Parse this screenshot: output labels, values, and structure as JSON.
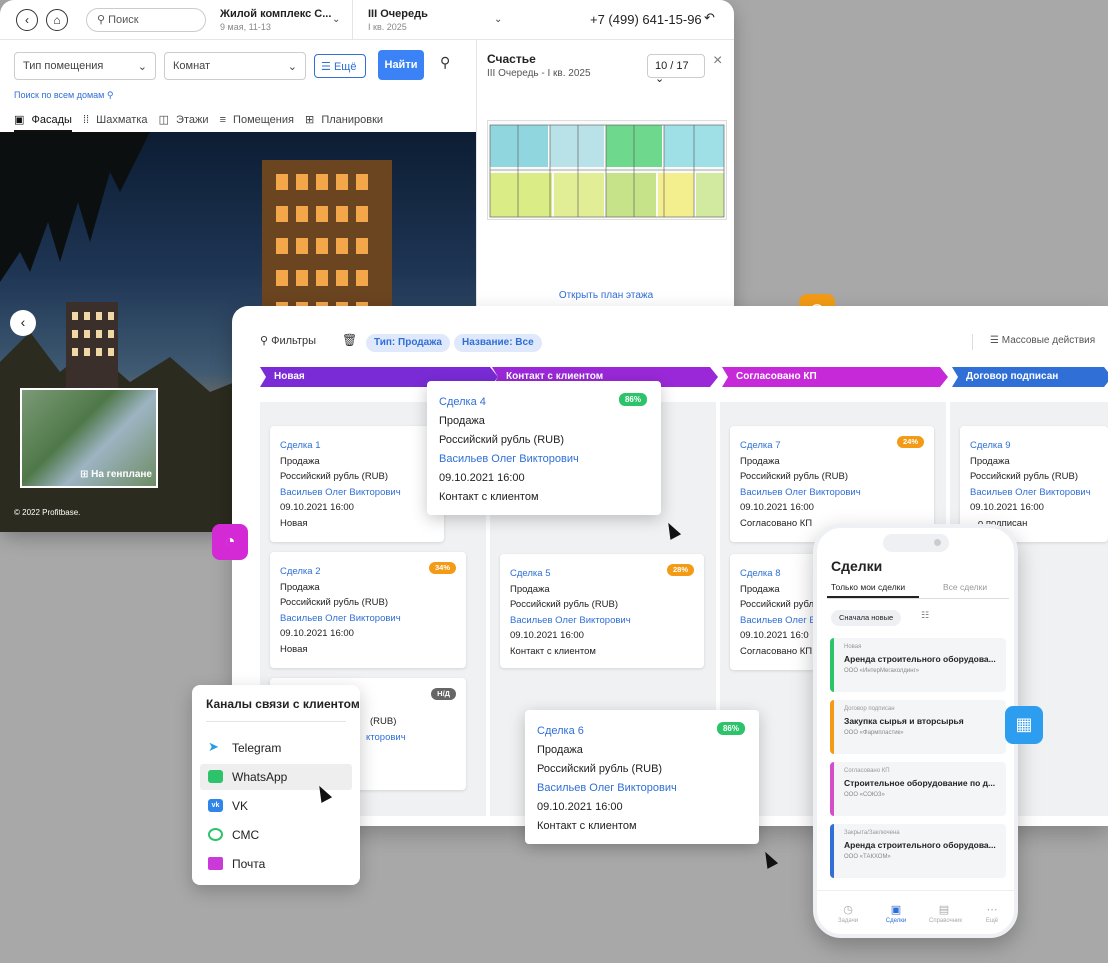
{
  "window": {
    "search_placeholder": "Поиск",
    "project_title": "Жилой комплекс С...",
    "project_sub": "9 мая, 11-13",
    "queue_title": "III Очередь",
    "queue_sub": "I кв. 2025",
    "phone": "+7 (499) 641-15-96",
    "room_type": "Тип помещения",
    "rooms": "Комнат",
    "more": "Ещё",
    "find": "Найти",
    "search_all": "Поиск по всем домам",
    "tabs": [
      "Фасады",
      "Шахматка",
      "Этажи",
      "Помещения",
      "Планировки"
    ],
    "genplan": "На генплане",
    "copyright": "© 2022 Profitbase.",
    "side_title": "Счастье",
    "side_sub": "III Очередь - I кв. 2025",
    "side_counter": "10 / 17",
    "open_plan": "Открыть план этажа"
  },
  "board": {
    "filters": "Фильтры",
    "chip_type": "Тип: Продажа",
    "chip_name": "Название: Все",
    "mass_actions": "Массовые действия",
    "stages": [
      "Новая",
      "Контакт с клиентом",
      "Согласовано КП",
      "Договор подписан"
    ],
    "deal_common": {
      "type": "Продажа",
      "currency": "Российский рубль (RUB)",
      "manager": "Васильев Олег Викторович",
      "date": "09.10.2021 16:00"
    },
    "deals": {
      "d1": {
        "title": "Сделка 1",
        "status": "Новая"
      },
      "d2": {
        "title": "Сделка 2",
        "status": "Новая",
        "badge": "34%"
      },
      "d3": {
        "badge": "Н/Д",
        "currency_tail": "(RUB)",
        "manager_tail": "кторович"
      },
      "d4": {
        "title": "Сделка 4",
        "status": "Контакт с клиентом",
        "badge": "86%"
      },
      "d5": {
        "title": "Сделка 5",
        "status": "Контакт с клиентом",
        "badge": "28%"
      },
      "d6": {
        "title": "Сделка 6",
        "status": "Контакт с клиентом",
        "badge": "86%"
      },
      "d7": {
        "title": "Сделка 7",
        "status": "Согласовано КП",
        "badge": "24%"
      },
      "d8": {
        "title": "Сделка 8",
        "status": "Согласовано КП",
        "currency": "Российский рубл",
        "manager": "Васильев Олег В",
        "date": "09.10.2021 16:0"
      },
      "d9": {
        "title": "Сделка 9",
        "status": "...о подписан"
      }
    }
  },
  "channels": {
    "title": "Каналы связи с клиентом",
    "items": [
      "Telegram",
      "WhatsApp",
      "VK",
      "СМС",
      "Почта"
    ]
  },
  "phone": {
    "title": "Сделки",
    "tab_mine": "Только мои сделки",
    "tab_all": "Все сделки",
    "sort": "Сначала новые",
    "cards": [
      {
        "stage": "Новая",
        "title": "Аренда строительного оборудова...",
        "company": "ООО «ИнтерМегахолдинг»",
        "color": "#2cc36b"
      },
      {
        "stage": "Договор подписан",
        "title": "Закупка сырья и вторсырья",
        "company": "ООО «Фармпластик»",
        "color": "#f39b16"
      },
      {
        "stage": "Согласовано КП",
        "title": "Строительное оборудование по д...",
        "company": "ООО «СОЮЗ»",
        "color": "#d34ec8"
      },
      {
        "stage": "Закрыта/Заключена",
        "title": "Аренда строительного оборудова...",
        "company": "ООО «ТАКХОМ»",
        "color": "#2f6fd6"
      }
    ],
    "nav": [
      "Задачи",
      "Сделки",
      "Справочник",
      "Ещё"
    ]
  },
  "colors": {
    "stage_new": "#7a2bd6",
    "stage_contact": "#9a28d8",
    "stage_kp": "#c62ad8",
    "stage_contract": "#2f6fd6",
    "badge_green": "#2cc36b",
    "badge_orange": "#f39b16",
    "badge_gray": "#666666",
    "accent_orange": "#f39b16",
    "accent_magenta": "#d42ad6"
  }
}
